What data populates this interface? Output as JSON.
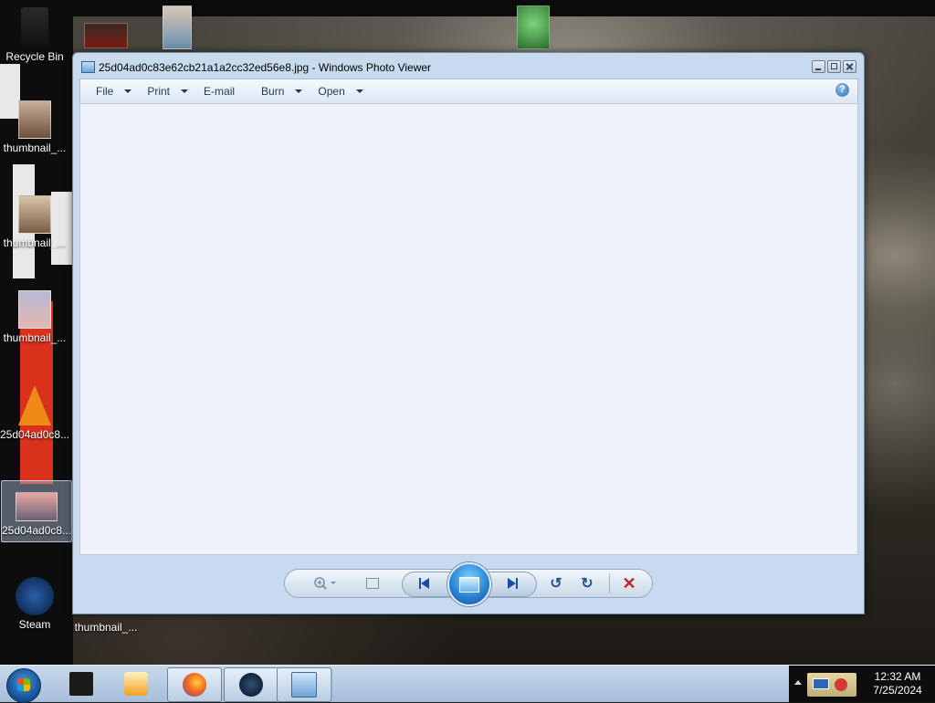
{
  "window": {
    "title": "25d04ad0c83e62cb21a1a2cc32ed56e8.jpg - Windows Photo Viewer"
  },
  "menu": {
    "items": [
      {
        "label": "File",
        "has_dropdown": true
      },
      {
        "label": "Print",
        "has_dropdown": true
      },
      {
        "label": "E-mail",
        "has_dropdown": false
      },
      {
        "label": "Burn",
        "has_dropdown": true
      },
      {
        "label": "Open",
        "has_dropdown": true
      }
    ],
    "help_glyph": "?"
  },
  "controls": {
    "zoom_icon": "magnifier-plus-icon",
    "fit_icon": "actual-size-icon",
    "prev_icon": "previous-icon",
    "slideshow_icon": "slideshow-icon",
    "next_icon": "next-icon",
    "rotate_ccw_glyph": "↺",
    "rotate_cw_glyph": "↻",
    "delete_glyph": "✕"
  },
  "desktop": {
    "icons": [
      {
        "label": "Recycle Bin"
      },
      {
        "label": "thumbnail_..."
      },
      {
        "label": "thumbnail_..."
      },
      {
        "label": "thumbnail_..."
      },
      {
        "label": "25d04ad0c8..."
      },
      {
        "label": "25d04ad0c8..."
      },
      {
        "label": "Steam"
      },
      {
        "label": "thumbnail_..."
      }
    ]
  },
  "taskbar": {
    "time": "12:32 AM",
    "date": "7/25/2024",
    "pinned": [
      "explorer-icon",
      "media-player-icon",
      "firefox-icon",
      "steam-icon",
      "photo-viewer-icon"
    ]
  },
  "colors": {
    "accent": "#1e395b",
    "viewer_bg": "#eef2f8",
    "delete": "#c02424"
  }
}
